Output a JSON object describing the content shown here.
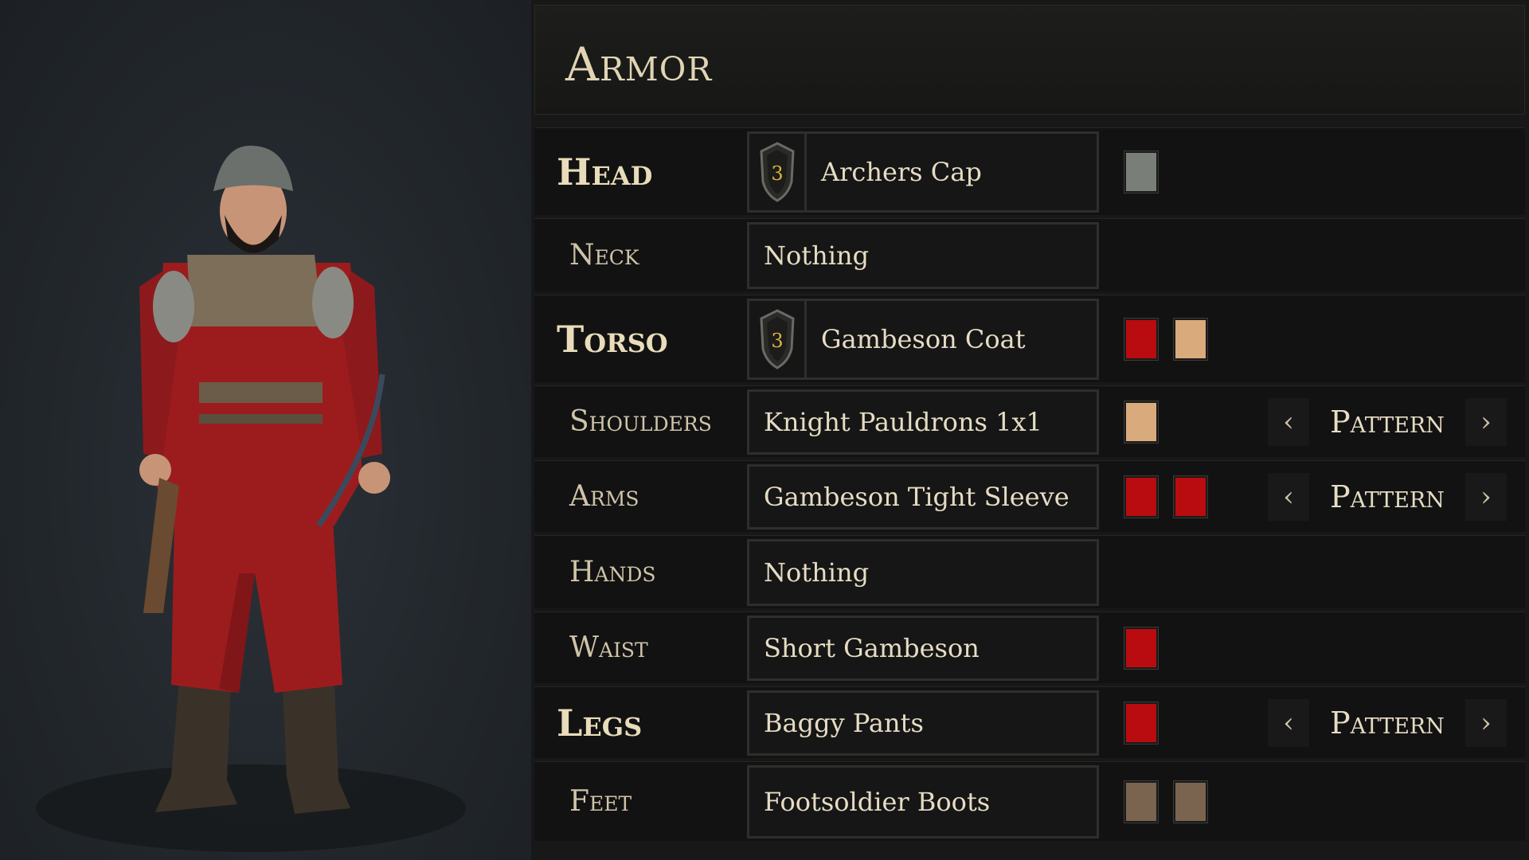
{
  "armor_panel": {
    "title": "Armor",
    "slots": [
      {
        "label": "Head",
        "major": true,
        "item": "Archers Cap",
        "tier": "3",
        "colors": [
          "#7a7e78"
        ],
        "pattern": null
      },
      {
        "label": "Neck",
        "major": false,
        "item": "Nothing",
        "tier": null,
        "colors": [],
        "pattern": null
      },
      {
        "label": "Torso",
        "major": true,
        "item": "Gambeson Coat",
        "tier": "3",
        "colors": [
          "#b80c10",
          "#d8aa7c"
        ],
        "pattern": null
      },
      {
        "label": "Shoulders",
        "major": false,
        "item": "Knight Pauldrons 1x1",
        "tier": null,
        "colors": [
          "#d8aa7c"
        ],
        "pattern": "Pattern"
      },
      {
        "label": "Arms",
        "major": false,
        "item": "Gambeson Tight Sleeve",
        "tier": null,
        "colors": [
          "#b80c10",
          "#b80c10"
        ],
        "pattern": "Pattern"
      },
      {
        "label": "Hands",
        "major": false,
        "item": "Nothing",
        "tier": null,
        "colors": [],
        "pattern": null
      },
      {
        "label": "Waist",
        "major": false,
        "item": "Short Gambeson",
        "tier": null,
        "colors": [
          "#b80c10"
        ],
        "pattern": null
      },
      {
        "label": "Legs",
        "major": true,
        "item": "Baggy Pants",
        "tier": null,
        "colors": [
          "#b80c10"
        ],
        "pattern": "Pattern"
      },
      {
        "label": "Feet",
        "major": false,
        "item": "Footsoldier Boots",
        "tier": null,
        "colors": [
          "#7a6450",
          "#7a6450"
        ],
        "pattern": null
      }
    ],
    "pattern_prev_icon": "chevron-left-icon",
    "pattern_next_icon": "chevron-right-icon"
  },
  "character_preview": {
    "palette": {
      "tunic": "#9c1c1e",
      "tunic_dark": "#6e1214",
      "leather": "#7c6e58",
      "metal": "#8a8a84",
      "boots": "#3a3228",
      "skin": "#c89478",
      "hat": "#6c706c",
      "beard": "#1a1614"
    }
  }
}
